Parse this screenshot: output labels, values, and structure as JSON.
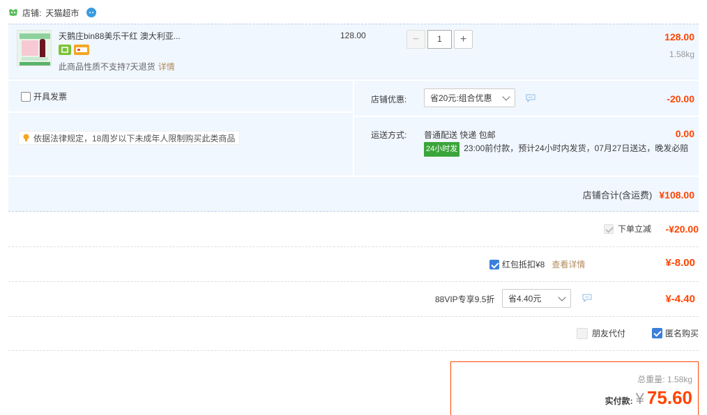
{
  "shop": {
    "label": "店铺:",
    "name": "天猫超市"
  },
  "item": {
    "title": "天鹅庄bin88美乐干红 澳大利亚...",
    "note": "此商品性质不支持7天退货",
    "note_link": "详情",
    "unit_price": "128.00",
    "quantity": "1",
    "line_total": "128.00",
    "weight": "1.58kg",
    "qty_minus": "−",
    "qty_plus": "+"
  },
  "invoice_label": "开具发票",
  "legal_notice": "依据法律规定，18周岁以下未成年人限制购买此类商品",
  "discount": {
    "label": "店铺优惠:",
    "selected": "省20元:组合优惠",
    "amount": "-20.00"
  },
  "shipping": {
    "label": "运送方式:",
    "method": "普通配送 快递 包邮",
    "tag": "24小时发",
    "detail": "23:00前付款，预计24小时内发货，07月27日送达，晚发必赔",
    "amount": "0.00"
  },
  "shop_total": {
    "label": "店铺合计(含运费)",
    "amount": "¥108.00"
  },
  "instant_discount": {
    "label": "下单立减",
    "amount": "-¥20.00"
  },
  "red_packet": {
    "label": "红包抵扣¥8",
    "link": "查看详情",
    "amount": "¥-8.00"
  },
  "vip": {
    "label": "88VIP专享9.5折",
    "selected": "省4.40元",
    "amount": "¥-4.40"
  },
  "friend_pay_label": "朋友代付",
  "anonymous_label": "匿名购买",
  "summary": {
    "weight_label": "总重量:",
    "weight": "1.58kg",
    "pay_label": "实付款:",
    "currency": "¥",
    "amount": "75.60"
  },
  "colors": {
    "accent_red": "#ff4400",
    "panel_blue": "#f1f7ff",
    "checkbox_blue": "#3b7fdb",
    "link_brown": "#b38b5d",
    "tag_green": "#3aa53a"
  }
}
